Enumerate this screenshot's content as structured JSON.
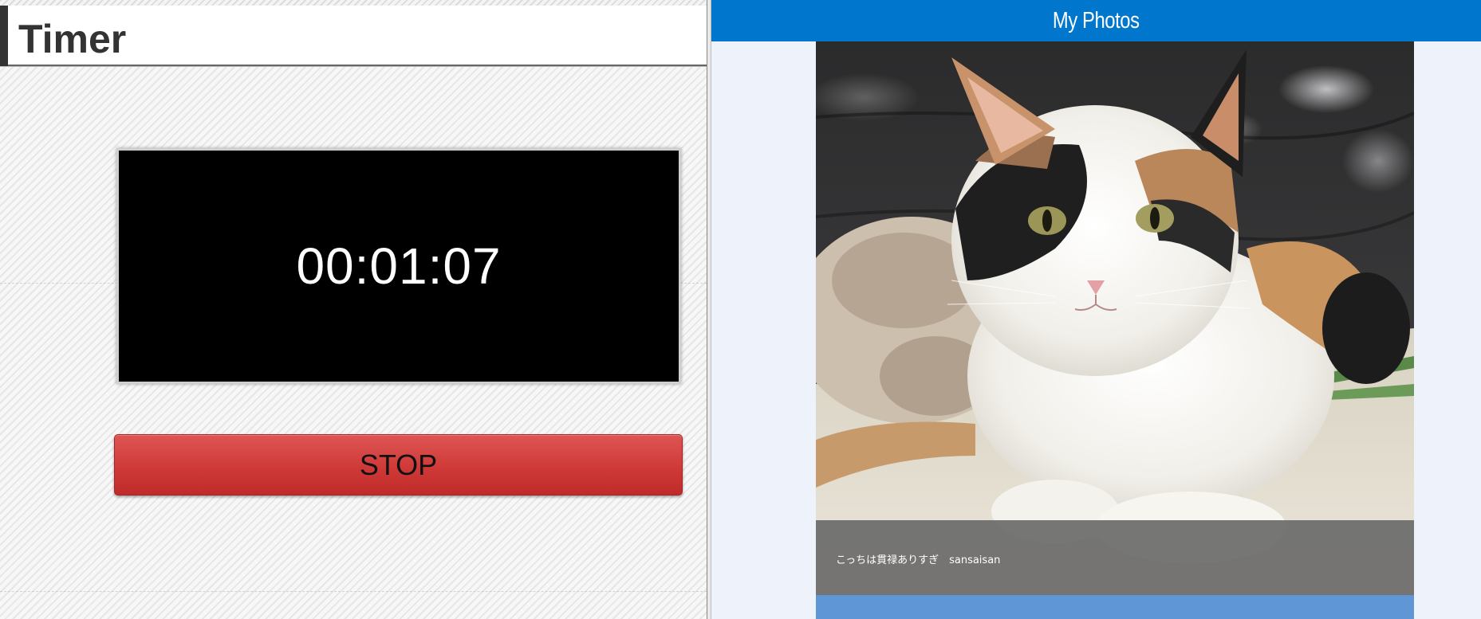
{
  "timer_app": {
    "title": "Timer",
    "elapsed": "00:01:07",
    "stop_label": "STOP"
  },
  "photos_app": {
    "title": "My Photos",
    "current_photo": {
      "subject": "calico cat lying on a black leather sofa",
      "caption": "こっちは貫禄ありすぎ　sansaisan"
    }
  },
  "colors": {
    "photos_header": "#0077cc",
    "stop_button": "#cf3a38",
    "timer_display_bg": "#000000",
    "photos_bg": "#eef3fb",
    "next_photo_strip": "#5f97d6"
  }
}
